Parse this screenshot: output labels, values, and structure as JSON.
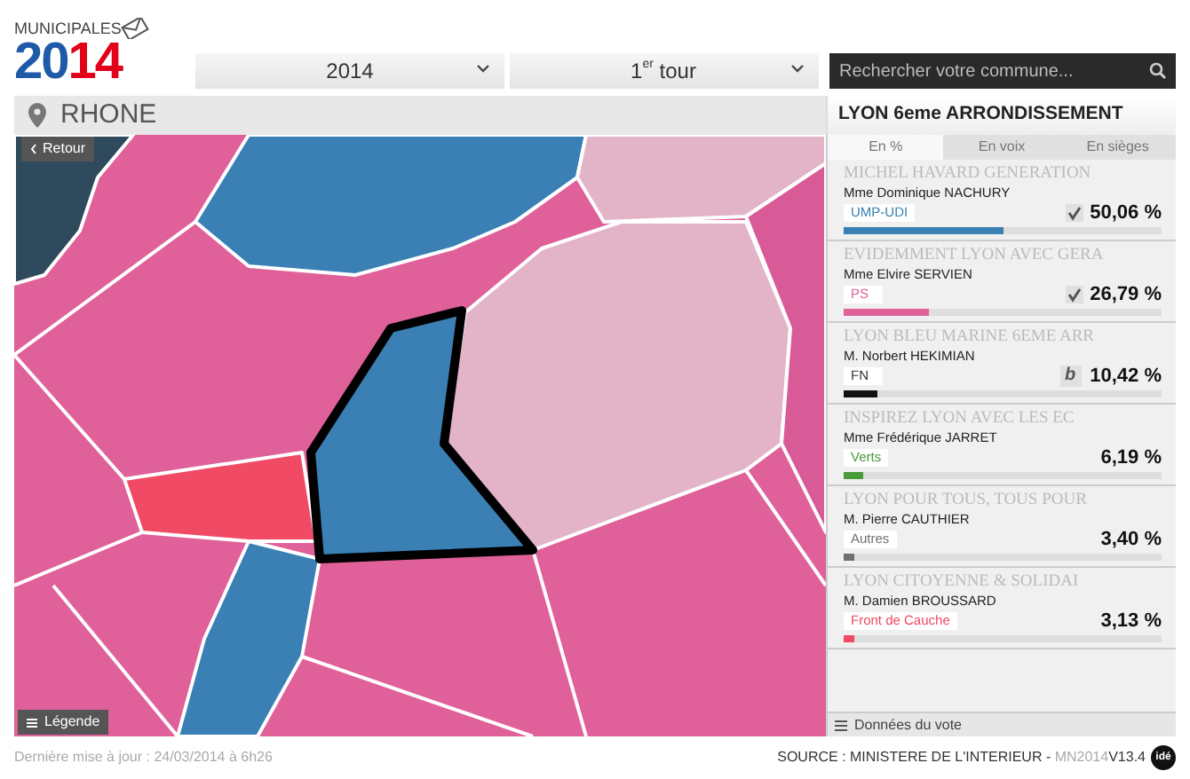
{
  "logo": {
    "top": "MUNICIPALES",
    "year": "2014"
  },
  "selects": [
    {
      "value": "2014"
    },
    {
      "value": "1",
      "sup": "er",
      "rest": " tour"
    }
  ],
  "search": {
    "placeholder": "Rechercher votre commune..."
  },
  "region": {
    "name": "RHONE"
  },
  "map": {
    "back": "Retour",
    "legend": "Légende"
  },
  "panel": {
    "title": "LYON 6eme ARRONDISSEMENT",
    "tabs": [
      {
        "label": "En %",
        "selected": true
      },
      {
        "label": "En voix",
        "selected": false
      },
      {
        "label": "En sièges",
        "selected": false
      }
    ],
    "lists": [
      {
        "name": "MICHEL HAVARD GENERATION",
        "candidate": "Mme Dominique NACHURY",
        "party": "UMP-UDI",
        "color": "#3a80b4",
        "kind": "elected",
        "percent": "50,06 %",
        "level": 0.5006
      },
      {
        "name": "EVIDEMMENT LYON AVEC GERA",
        "candidate": "Mme Elvire SERVIEN",
        "party": "PS",
        "color": "#e0609a",
        "kind": "elected",
        "percent": "26,79 %",
        "level": 0.2679
      },
      {
        "name": "LYON BLEU MARINE 6EME ARR",
        "candidate": "M. Norbert HEKIMIAN",
        "party": "FN",
        "color": "#111111",
        "kind": "runoff",
        "runoff_label": "b",
        "percent": "10,42 %",
        "level": 0.1042
      },
      {
        "name": "INSPIREZ LYON AVEC LES EC",
        "candidate": "Mme Frédérique JARRET",
        "party": "Verts",
        "color": "#4a9a3a",
        "kind": "plain",
        "percent": "6,19 %",
        "level": 0.0619
      },
      {
        "name": "LYON POUR TOUS, TOUS POUR",
        "candidate": "M. Pierre CAUTHIER",
        "party": "Autres",
        "color": "#707070",
        "kind": "plain",
        "percent": "3,40 %",
        "level": 0.034
      },
      {
        "name": "LYON CITOYENNE & SOLIDAI",
        "candidate": "M. Damien BROUSSARD",
        "party": "Front de Cauche",
        "color": "#f04a64",
        "kind": "plain",
        "percent": "3,13 %",
        "level": 0.0313
      }
    ],
    "footer": "Données du vote"
  },
  "updated": "Dernière mise à jour : 24/03/2014 à 6h26",
  "source": {
    "text": "SOURCE : MINISTERE DE L'INTERIEUR - ",
    "code": "MN2014",
    "version": "V13.4",
    "brand": "idé"
  }
}
